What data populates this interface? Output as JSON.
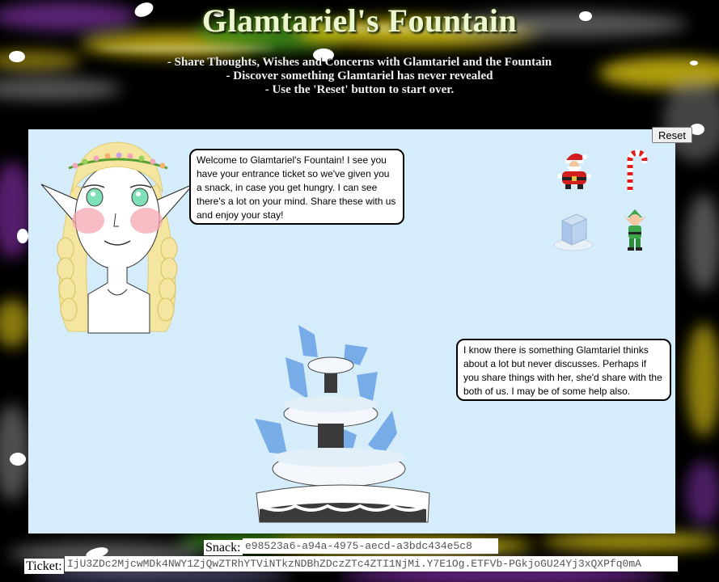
{
  "header": {
    "title": "Glamtariel's Fountain",
    "instructions": [
      "- Share Thoughts, Wishes and Concerns with Glamtariel and the Fountain",
      "- Discover something Glamtariel has never revealed",
      "- Use the 'Reset' button to start over."
    ]
  },
  "controls": {
    "reset_label": "Reset"
  },
  "bubbles": {
    "glamtariel": "Welcome to Glamtariel's Fountain! I see you have your entrance ticket so we've given you a snack, in case you get hungry. I can see there's a lot on your mind. Share these with us and enjoy your stay!",
    "fountain": "I know there is something Glamtariel thinks about a lot but never discusses. Perhaps if you share things with her, she'd share with the both of us. I may be of some help also."
  },
  "items": [
    "santa-icon",
    "candy-cane-icon",
    "ice-cube-icon",
    "elf-icon"
  ],
  "footer": {
    "snack_label": "Snack:",
    "snack_value": "e98523a6-a94a-4975-aecd-a3bdc434e5c8",
    "ticket_label": "Ticket:",
    "ticket_value": "IjU3ZDc2MjcwMDk4NWY1ZjQwZTRhYTViNTkzNDBhZDczZTc4ZTI1NjMi.Y7E1Og.ETFVb-PGkjoGU24Yj3xQXPfq0mA"
  },
  "colors": {
    "panel_bg": "#d5ecfb",
    "title": "#ecf7d0",
    "background": "#000000"
  }
}
